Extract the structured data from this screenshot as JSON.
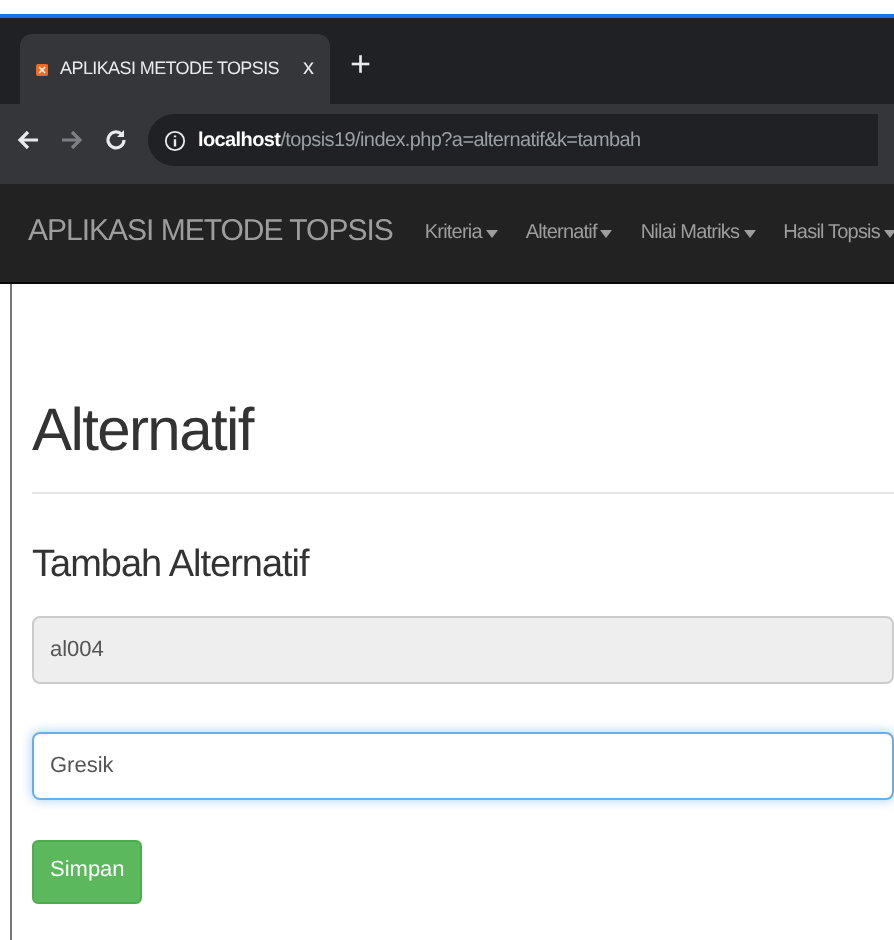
{
  "browser": {
    "tab_title": "APLIKASI METODE TOPSIS",
    "tab_close": "x",
    "new_tab": "+",
    "url_host": "localhost",
    "url_path": "/topsis19/index.php?a=alternatif&k=tambah"
  },
  "navbar": {
    "brand": "APLIKASI METODE TOPSIS",
    "menus": [
      {
        "label": "Kriteria"
      },
      {
        "label": "Alternatif"
      },
      {
        "label": "Nilai Matriks"
      },
      {
        "label": "Hasil Topsis"
      }
    ]
  },
  "page": {
    "title": "Alternatif",
    "subtitle": "Tambah Alternatif"
  },
  "fields": [
    {
      "value": "al004",
      "readonly": true,
      "focused": false
    },
    {
      "value": "Gresik",
      "readonly": false,
      "focused": true
    }
  ],
  "submit": "Simpan"
}
